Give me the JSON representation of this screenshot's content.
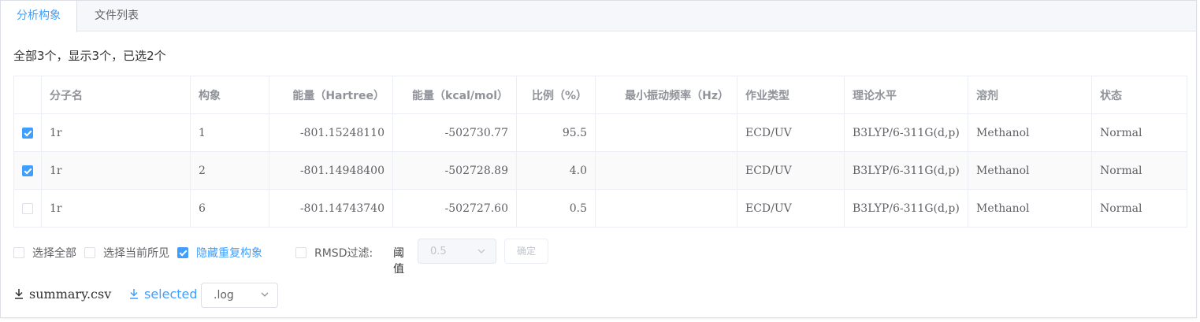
{
  "tabs": [
    {
      "label": "分析构象",
      "active": true
    },
    {
      "label": "文件列表",
      "active": false
    }
  ],
  "summary_text": "全部3个，显示3个，已选2个",
  "table": {
    "columns": [
      "",
      "分子名",
      "构象",
      "能量（Hartree）",
      "能量（kcal/mol）",
      "比例（%）",
      "最小振动频率（Hz）",
      "作业类型",
      "理论水平",
      "溶剂",
      "状态"
    ],
    "rows": [
      {
        "checked": true,
        "name": "1r",
        "conformer": "1",
        "energy_hartree": "-801.15248110",
        "energy_kcal": "-502730.77",
        "ratio": "95.5",
        "min_freq": "",
        "job_type": "ECD/UV",
        "level": "B3LYP/6-311G(d,p)",
        "solvent": "Methanol",
        "status": "Normal"
      },
      {
        "checked": true,
        "name": "1r",
        "conformer": "2",
        "energy_hartree": "-801.14948400",
        "energy_kcal": "-502728.89",
        "ratio": "4.0",
        "min_freq": "",
        "job_type": "ECD/UV",
        "level": "B3LYP/6-311G(d,p)",
        "solvent": "Methanol",
        "status": "Normal"
      },
      {
        "checked": false,
        "name": "1r",
        "conformer": "6",
        "energy_hartree": "-801.14743740",
        "energy_kcal": "-502727.60",
        "ratio": "0.5",
        "min_freq": "",
        "job_type": "ECD/UV",
        "level": "B3LYP/6-311G(d,p)",
        "solvent": "Methanol",
        "status": "Normal"
      }
    ]
  },
  "options": {
    "select_all": {
      "label": "选择全部",
      "checked": false
    },
    "select_visible": {
      "label": "选择当前所见",
      "checked": false
    },
    "hide_duplicates": {
      "label": "隐藏重复构象",
      "checked": true
    },
    "rmsd_filter": {
      "label": "RMSD过滤:",
      "checked": false
    },
    "threshold_label": "阈值",
    "threshold_value": "0.5",
    "confirm_label": "确定"
  },
  "downloads": {
    "summary_label": "summary.csv",
    "selected_label": "selected",
    "ext_value": ".log"
  },
  "colors": {
    "accent": "#409eff",
    "border": "#dcdfe6",
    "header_text": "#909399",
    "body_text": "#606266"
  }
}
